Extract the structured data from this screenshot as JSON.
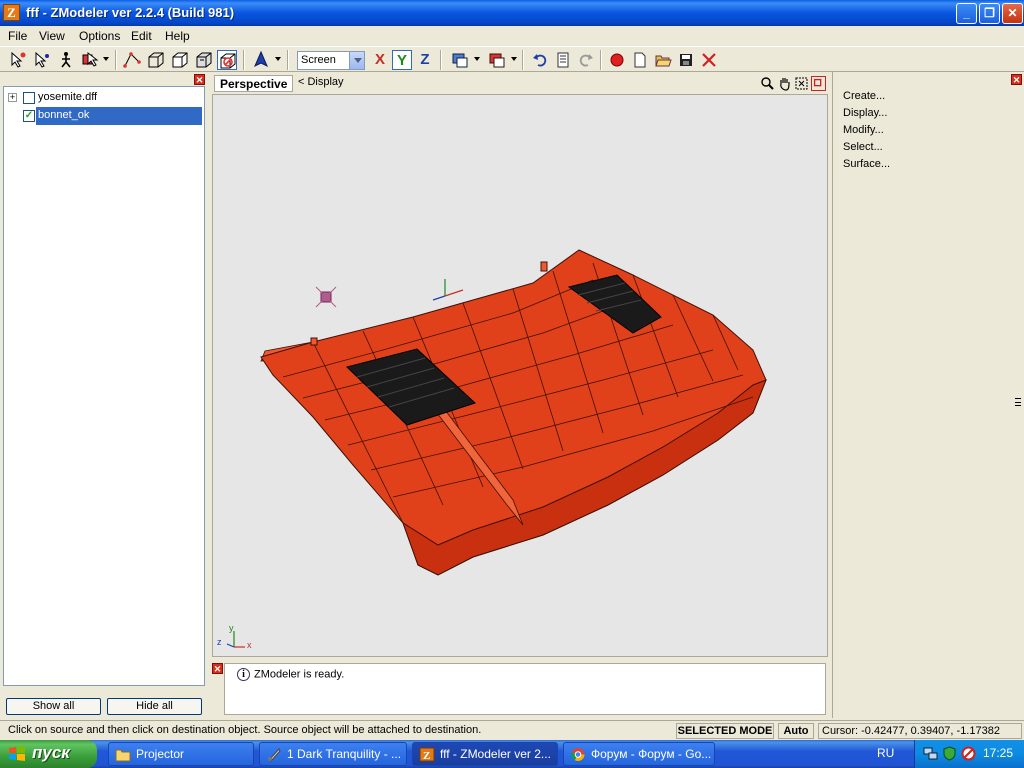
{
  "window": {
    "title": "fff - ZModeler ver 2.2.4 (Build 981)",
    "app_icon_letter": "Z",
    "minimize": "_",
    "maximize": "❐",
    "close": "✕"
  },
  "menu": {
    "items": [
      {
        "label": "File"
      },
      {
        "label": "View"
      },
      {
        "label": "Options"
      },
      {
        "label": "Edit"
      },
      {
        "label": "Help"
      }
    ]
  },
  "toolbar": {
    "coord_select": "Screen",
    "axis_x": "X",
    "axis_y": "Y",
    "axis_z": "Z",
    "colors": {
      "x": "#C0302A",
      "y": "#1E8A1E",
      "z": "#1E3FA8"
    }
  },
  "tree": {
    "items": [
      {
        "label": "yosemite.dff",
        "checked": false,
        "expander": "+"
      },
      {
        "label": "bonnet_ok",
        "checked": true,
        "selected": true
      }
    ],
    "check_mark": "✓",
    "show_all": "Show all",
    "hide_all": "Hide all"
  },
  "viewport": {
    "tab": "Perspective",
    "mode": "<  Display",
    "axis_labels": {
      "z": "z",
      "y": "y",
      "x": "x"
    },
    "model_color": "#E0401A",
    "vent_color": "#1A1A1A",
    "background": "#E6E6E6"
  },
  "log": {
    "message": "ZModeler is ready.",
    "info_icon": "i"
  },
  "right_panel": {
    "items": [
      {
        "label": "Create..."
      },
      {
        "label": "Display..."
      },
      {
        "label": "Modify..."
      },
      {
        "label": "Select..."
      },
      {
        "label": "Surface..."
      }
    ]
  },
  "status": {
    "message": "Click on source and then click on destination object. Source object will be attached to destination.",
    "mode": "SELECTED MODE",
    "auto": "Auto",
    "cursor": "Cursor: -0.42477, 0.39407, -1.17382"
  },
  "taskbar": {
    "start": "пуск",
    "tasks": [
      {
        "label": "Projector",
        "icon": "folder-icon"
      },
      {
        "label": "1 Dark Tranquility - ...",
        "icon": "media-icon"
      },
      {
        "label": "fff - ZModeler ver 2...",
        "icon": "zmodeler-icon",
        "active": true
      },
      {
        "label": "Форум - Форум - Go...",
        "icon": "chrome-icon"
      }
    ],
    "lang": "RU",
    "clock": "17:25"
  }
}
